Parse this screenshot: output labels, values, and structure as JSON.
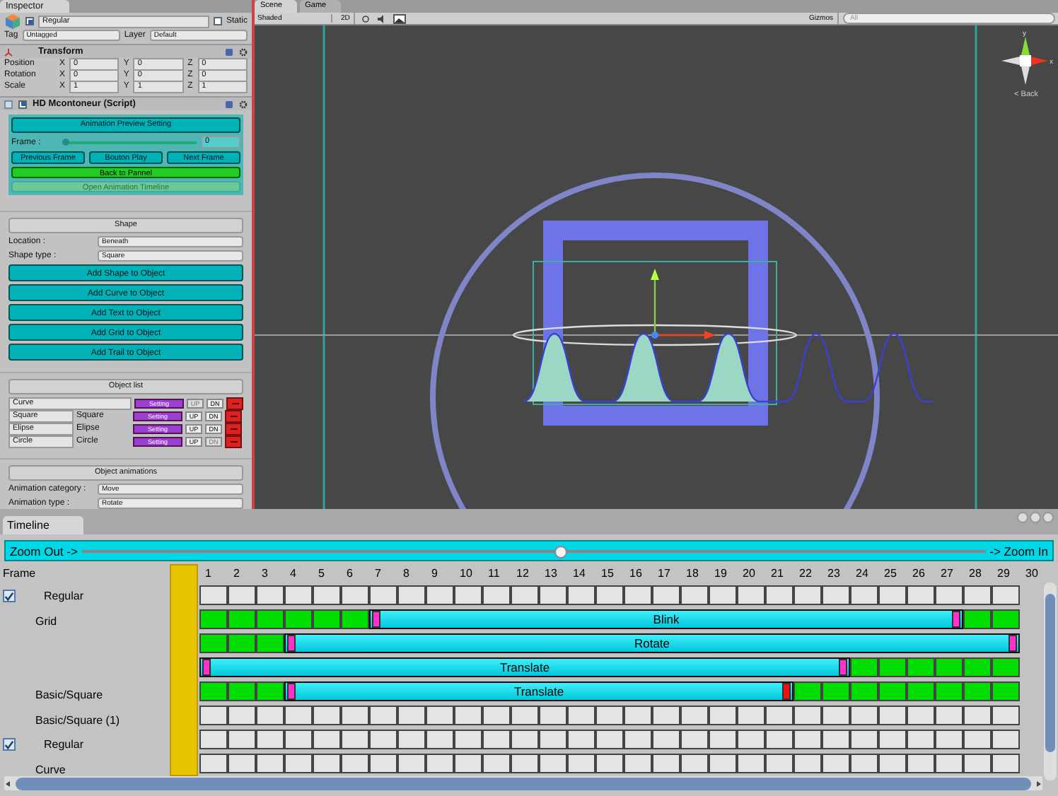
{
  "inspector": {
    "tab": "Inspector",
    "object_name": "Regular",
    "active": true,
    "static_label": "Static",
    "static": false,
    "tag_label": "Tag",
    "tag": "Untagged",
    "layer_label": "Layer",
    "layer": "Default",
    "transform": {
      "title": "Transform",
      "rows": [
        {
          "label": "Position",
          "fields": [
            {
              "axis": "X",
              "value": "0"
            },
            {
              "axis": "Y",
              "value": "0"
            },
            {
              "axis": "Z",
              "value": "0"
            }
          ]
        },
        {
          "label": "Rotation",
          "fields": [
            {
              "axis": "X",
              "value": "0"
            },
            {
              "axis": "Y",
              "value": "0"
            },
            {
              "axis": "Z",
              "value": "0"
            }
          ]
        },
        {
          "label": "Scale",
          "fields": [
            {
              "axis": "X",
              "value": "1"
            },
            {
              "axis": "Y",
              "value": "1"
            },
            {
              "axis": "Z",
              "value": "1"
            }
          ]
        }
      ]
    },
    "script": {
      "title": "HD Mcontoneur (Script)",
      "enabled": true
    },
    "preview": {
      "title": "Animation Preview Setting",
      "frame_label": "Frame :",
      "frame_value": "0",
      "level": 0,
      "buttons": [
        "Previous Frame",
        "Bouton Play",
        "Next Frame"
      ],
      "back": "Back to Pannel",
      "open_timeline": {
        "label": "Open Animation Timeline",
        "disabled": true
      }
    },
    "shape": {
      "title": "Shape",
      "fields": [
        {
          "label": "Location :",
          "value": "Beneath"
        },
        {
          "label": "Shape type :",
          "value": "Square"
        }
      ],
      "buttons": [
        "Add Shape to Object",
        "Add Curve to Object",
        "Add Text to Object",
        "Add Grid to Object",
        "Add Trail to Object"
      ]
    },
    "object_list": {
      "title": "Object list",
      "rows": [
        {
          "name": "Curve",
          "setting": "Setting",
          "up": "UP",
          "dn": "DN",
          "up_disabled": true,
          "dn_disabled": false
        },
        {
          "name": "Square",
          "type": "Square",
          "setting": "Setting",
          "up": "UP",
          "dn": "DN",
          "up_disabled": false,
          "dn_disabled": false
        },
        {
          "name": "Elipse",
          "type": "Elipse",
          "setting": "Setting",
          "up": "UP",
          "dn": "DN",
          "up_disabled": false,
          "dn_disabled": false
        },
        {
          "name": "Circle",
          "type": "Circle",
          "setting": "Setting",
          "up": "UP",
          "dn": "DN",
          "up_disabled": false,
          "dn_disabled": true
        }
      ]
    },
    "animations": {
      "title": "Object animations",
      "fields": [
        {
          "label": "Animation category :",
          "value": "Move"
        },
        {
          "label": "Animation type :",
          "value": "Rotate"
        }
      ]
    }
  },
  "scene": {
    "tabs": [
      {
        "label": "Scene",
        "selected": true
      },
      {
        "label": "Game",
        "selected": false
      }
    ],
    "shading": "Shaded",
    "mode_2d": "2D",
    "gizmos": "Gizmos",
    "search_placeholder": "All",
    "gizmo_axes": [
      "y",
      "x"
    ],
    "back": "< Back"
  },
  "timeline": {
    "tab": "Timeline",
    "zoom_out": "Zoom Out ->",
    "zoom_in": "-> Zoom In",
    "level": 0.53,
    "frame_header": "Frame",
    "frames": [
      "1",
      "2",
      "3",
      "4",
      "5",
      "6",
      "7",
      "8",
      "9",
      "10",
      "11",
      "12",
      "13",
      "14",
      "15",
      "16",
      "17",
      "18",
      "19",
      "20",
      "21",
      "22",
      "23",
      "24",
      "25",
      "26",
      "27",
      "28",
      "29",
      "30"
    ],
    "rows": [
      {
        "kind": "group",
        "label": "Regular",
        "checked": true,
        "cells": [
          {
            "kind": "empty"
          },
          {
            "kind": "empty"
          },
          {
            "kind": "empty"
          },
          {
            "kind": "empty"
          },
          {
            "kind": "empty"
          },
          {
            "kind": "empty"
          },
          {
            "kind": "empty"
          },
          {
            "kind": "empty"
          },
          {
            "kind": "empty"
          },
          {
            "kind": "empty"
          },
          {
            "kind": "empty"
          },
          {
            "kind": "empty"
          },
          {
            "kind": "empty"
          },
          {
            "kind": "empty"
          },
          {
            "kind": "empty"
          },
          {
            "kind": "empty"
          },
          {
            "kind": "empty"
          },
          {
            "kind": "empty"
          },
          {
            "kind": "empty"
          },
          {
            "kind": "empty"
          },
          {
            "kind": "empty"
          },
          {
            "kind": "empty"
          },
          {
            "kind": "empty"
          },
          {
            "kind": "empty"
          },
          {
            "kind": "empty"
          },
          {
            "kind": "empty"
          },
          {
            "kind": "empty"
          },
          {
            "kind": "empty"
          },
          {
            "kind": "empty"
          }
        ],
        "clips": []
      },
      {
        "kind": "track",
        "label": "Grid",
        "cells": [
          {
            "kind": "key"
          },
          {
            "kind": "key"
          },
          {
            "kind": "key"
          },
          {
            "kind": "key"
          },
          {
            "kind": "key"
          },
          {
            "kind": "key"
          },
          {
            "kind": "clip"
          },
          {
            "kind": "clip"
          },
          {
            "kind": "clip"
          },
          {
            "kind": "clip"
          },
          {
            "kind": "clip"
          },
          {
            "kind": "clip"
          },
          {
            "kind": "clip"
          },
          {
            "kind": "clip"
          },
          {
            "kind": "clip"
          },
          {
            "kind": "clip"
          },
          {
            "kind": "clip"
          },
          {
            "kind": "clip"
          },
          {
            "kind": "clip"
          },
          {
            "kind": "clip"
          },
          {
            "kind": "clip"
          },
          {
            "kind": "clip"
          },
          {
            "kind": "clip"
          },
          {
            "kind": "clip"
          },
          {
            "kind": "clip"
          },
          {
            "kind": "clip"
          },
          {
            "kind": "clip"
          },
          {
            "kind": "key"
          },
          {
            "kind": "key"
          }
        ],
        "clips": [
          {
            "label": "Blink",
            "markers": [
              {
                "color": "#ff33cc"
              },
              {
                "color": "#ff33cc"
              }
            ]
          }
        ]
      },
      {
        "kind": "track",
        "cells": [
          {
            "kind": "key"
          },
          {
            "kind": "key"
          },
          {
            "kind": "key"
          },
          {
            "kind": "clip"
          },
          {
            "kind": "clip"
          },
          {
            "kind": "clip"
          },
          {
            "kind": "clip"
          },
          {
            "kind": "clip"
          },
          {
            "kind": "clip"
          },
          {
            "kind": "clip"
          },
          {
            "kind": "clip"
          },
          {
            "kind": "clip"
          },
          {
            "kind": "clip"
          },
          {
            "kind": "clip"
          },
          {
            "kind": "clip"
          },
          {
            "kind": "clip"
          },
          {
            "kind": "clip"
          },
          {
            "kind": "clip"
          },
          {
            "kind": "clip"
          },
          {
            "kind": "clip"
          },
          {
            "kind": "clip"
          },
          {
            "kind": "clip"
          },
          {
            "kind": "clip"
          },
          {
            "kind": "clip"
          },
          {
            "kind": "clip"
          },
          {
            "kind": "clip"
          },
          {
            "kind": "clip"
          },
          {
            "kind": "clip"
          },
          {
            "kind": "clip"
          }
        ],
        "clips": [
          {
            "label": "Rotate",
            "markers": [
              {
                "color": "#ff33cc"
              },
              {
                "color": "#ff33cc"
              }
            ]
          }
        ]
      },
      {
        "kind": "track",
        "cells": [
          {
            "kind": "clip"
          },
          {
            "kind": "clip"
          },
          {
            "kind": "clip"
          },
          {
            "kind": "clip"
          },
          {
            "kind": "clip"
          },
          {
            "kind": "clip"
          },
          {
            "kind": "clip"
          },
          {
            "kind": "clip"
          },
          {
            "kind": "clip"
          },
          {
            "kind": "clip"
          },
          {
            "kind": "clip"
          },
          {
            "kind": "clip"
          },
          {
            "kind": "clip"
          },
          {
            "kind": "clip"
          },
          {
            "kind": "clip"
          },
          {
            "kind": "clip"
          },
          {
            "kind": "clip"
          },
          {
            "kind": "clip"
          },
          {
            "kind": "clip"
          },
          {
            "kind": "clip"
          },
          {
            "kind": "clip"
          },
          {
            "kind": "clip"
          },
          {
            "kind": "clip"
          },
          {
            "kind": "key"
          },
          {
            "kind": "key"
          },
          {
            "kind": "key"
          },
          {
            "kind": "key"
          },
          {
            "kind": "key"
          },
          {
            "kind": "key"
          }
        ],
        "clips": [
          {
            "label": "Translate",
            "markers": [
              {
                "color": "#ff33cc"
              },
              {
                "color": "#ff33cc"
              }
            ]
          }
        ]
      },
      {
        "kind": "track",
        "label": "Basic/Square",
        "cells": [
          {
            "kind": "key"
          },
          {
            "kind": "key"
          },
          {
            "kind": "key"
          },
          {
            "kind": "clip"
          },
          {
            "kind": "clip"
          },
          {
            "kind": "clip"
          },
          {
            "kind": "clip"
          },
          {
            "kind": "clip"
          },
          {
            "kind": "clip"
          },
          {
            "kind": "clip"
          },
          {
            "kind": "clip"
          },
          {
            "kind": "clip"
          },
          {
            "kind": "clip"
          },
          {
            "kind": "clip"
          },
          {
            "kind": "clip"
          },
          {
            "kind": "clip"
          },
          {
            "kind": "clip"
          },
          {
            "kind": "clip"
          },
          {
            "kind": "clip"
          },
          {
            "kind": "clip"
          },
          {
            "kind": "clip"
          },
          {
            "kind": "key"
          },
          {
            "kind": "key"
          },
          {
            "kind": "key"
          },
          {
            "kind": "key"
          },
          {
            "kind": "key"
          },
          {
            "kind": "key"
          },
          {
            "kind": "key"
          },
          {
            "kind": "key"
          }
        ],
        "clips": [
          {
            "label": "Translate",
            "markers": [
              {
                "color": "#ff33cc"
              },
              {
                "color": "#ee1111"
              }
            ]
          }
        ]
      },
      {
        "kind": "track",
        "label": "Basic/Square (1)",
        "cells": [
          {
            "kind": "empty"
          },
          {
            "kind": "empty"
          },
          {
            "kind": "empty"
          },
          {
            "kind": "empty"
          },
          {
            "kind": "empty"
          },
          {
            "kind": "empty"
          },
          {
            "kind": "empty"
          },
          {
            "kind": "empty"
          },
          {
            "kind": "empty"
          },
          {
            "kind": "empty"
          },
          {
            "kind": "empty"
          },
          {
            "kind": "empty"
          },
          {
            "kind": "empty"
          },
          {
            "kind": "empty"
          },
          {
            "kind": "empty"
          },
          {
            "kind": "empty"
          },
          {
            "kind": "empty"
          },
          {
            "kind": "empty"
          },
          {
            "kind": "empty"
          },
          {
            "kind": "empty"
          },
          {
            "kind": "empty"
          },
          {
            "kind": "empty"
          },
          {
            "kind": "empty"
          },
          {
            "kind": "empty"
          },
          {
            "kind": "empty"
          },
          {
            "kind": "empty"
          },
          {
            "kind": "empty"
          },
          {
            "kind": "empty"
          },
          {
            "kind": "empty"
          }
        ],
        "clips": []
      },
      {
        "kind": "group",
        "label": "Regular",
        "checked": true,
        "cells": [
          {
            "kind": "empty"
          },
          {
            "kind": "empty"
          },
          {
            "kind": "empty"
          },
          {
            "kind": "empty"
          },
          {
            "kind": "empty"
          },
          {
            "kind": "empty"
          },
          {
            "kind": "empty"
          },
          {
            "kind": "empty"
          },
          {
            "kind": "empty"
          },
          {
            "kind": "empty"
          },
          {
            "kind": "empty"
          },
          {
            "kind": "empty"
          },
          {
            "kind": "empty"
          },
          {
            "kind": "empty"
          },
          {
            "kind": "empty"
          },
          {
            "kind": "empty"
          },
          {
            "kind": "empty"
          },
          {
            "kind": "empty"
          },
          {
            "kind": "empty"
          },
          {
            "kind": "empty"
          },
          {
            "kind": "empty"
          },
          {
            "kind": "empty"
          },
          {
            "kind": "empty"
          },
          {
            "kind": "empty"
          },
          {
            "kind": "empty"
          },
          {
            "kind": "empty"
          },
          {
            "kind": "empty"
          },
          {
            "kind": "empty"
          },
          {
            "kind": "empty"
          }
        ],
        "clips": []
      },
      {
        "kind": "track",
        "label": "Curve",
        "cells": [
          {
            "kind": "empty"
          },
          {
            "kind": "empty"
          },
          {
            "kind": "empty"
          },
          {
            "kind": "empty"
          },
          {
            "kind": "empty"
          },
          {
            "kind": "empty"
          },
          {
            "kind": "empty"
          },
          {
            "kind": "empty"
          },
          {
            "kind": "empty"
          },
          {
            "kind": "empty"
          },
          {
            "kind": "empty"
          },
          {
            "kind": "empty"
          },
          {
            "kind": "empty"
          },
          {
            "kind": "empty"
          },
          {
            "kind": "empty"
          },
          {
            "kind": "empty"
          },
          {
            "kind": "empty"
          },
          {
            "kind": "empty"
          },
          {
            "kind": "empty"
          },
          {
            "kind": "empty"
          },
          {
            "kind": "empty"
          },
          {
            "kind": "empty"
          },
          {
            "kind": "empty"
          },
          {
            "kind": "empty"
          },
          {
            "kind": "empty"
          },
          {
            "kind": "empty"
          },
          {
            "kind": "empty"
          },
          {
            "kind": "empty"
          },
          {
            "kind": "empty"
          }
        ],
        "clips": []
      }
    ]
  }
}
